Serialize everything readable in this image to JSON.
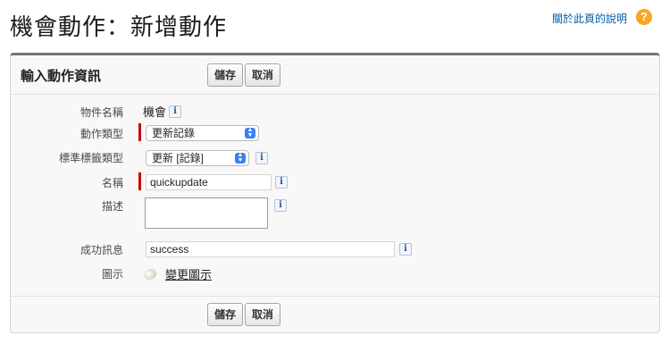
{
  "page": {
    "title": "機會動作：新增動作",
    "help_link": "關於此頁的說明",
    "help_icon": "?"
  },
  "panel": {
    "title": "輸入動作資訊",
    "save_label": "儲存",
    "cancel_label": "取消"
  },
  "fields": {
    "object_name": {
      "label": "物件名稱",
      "value": "機會"
    },
    "action_type": {
      "label": "動作類型",
      "value": "更新記錄"
    },
    "standard_label_type": {
      "label": "標準標籤類型",
      "value": "更新 [記錄]"
    },
    "name": {
      "label": "名稱",
      "value": "quickupdate"
    },
    "description": {
      "label": "描述",
      "value": ""
    },
    "success_message": {
      "label": "成功訊息",
      "value": "success"
    },
    "icon": {
      "label": "圖示",
      "link": "變更圖示"
    }
  },
  "info_glyph": "i"
}
